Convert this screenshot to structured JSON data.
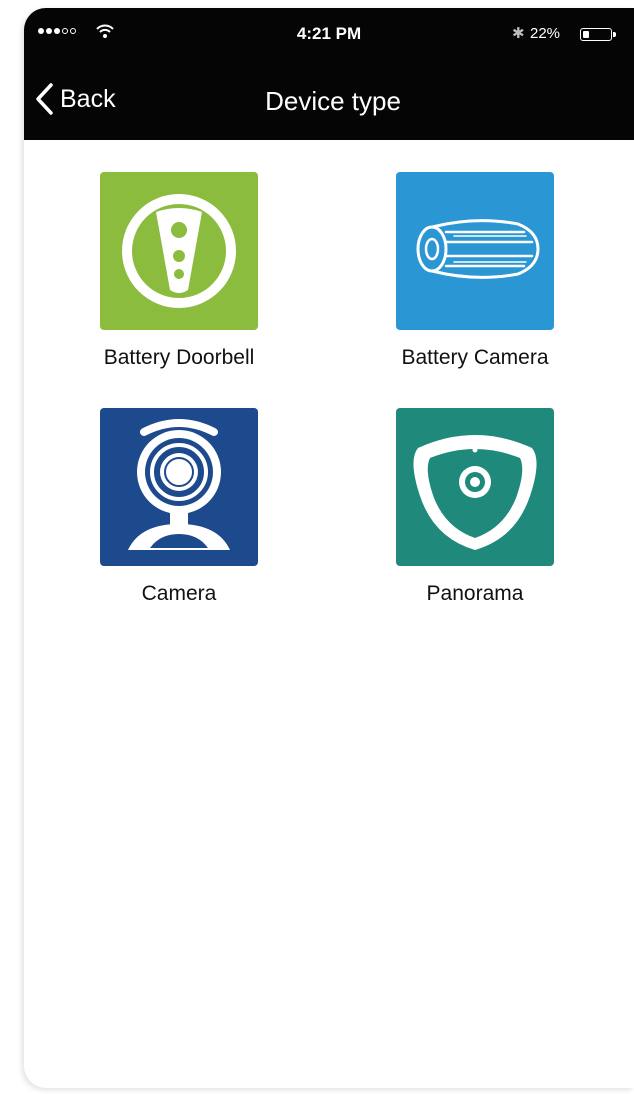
{
  "status_bar": {
    "time": "4:21 PM",
    "battery_percent": "22%",
    "battery_level": 0.22,
    "signal_bars": 3,
    "signal_total": 5
  },
  "nav": {
    "back_label": "Back",
    "title": "Device type"
  },
  "devices": [
    {
      "label": "Battery Doorbell",
      "icon": "doorbell-icon",
      "color": "#8cbc3d"
    },
    {
      "label": "Battery Camera",
      "icon": "battery-camera-icon",
      "color": "#2a96d4"
    },
    {
      "label": "Camera",
      "icon": "webcam-icon",
      "color": "#1c4a8c"
    },
    {
      "label": "Panorama",
      "icon": "panorama-camera-icon",
      "color": "#1f8a7c"
    }
  ]
}
